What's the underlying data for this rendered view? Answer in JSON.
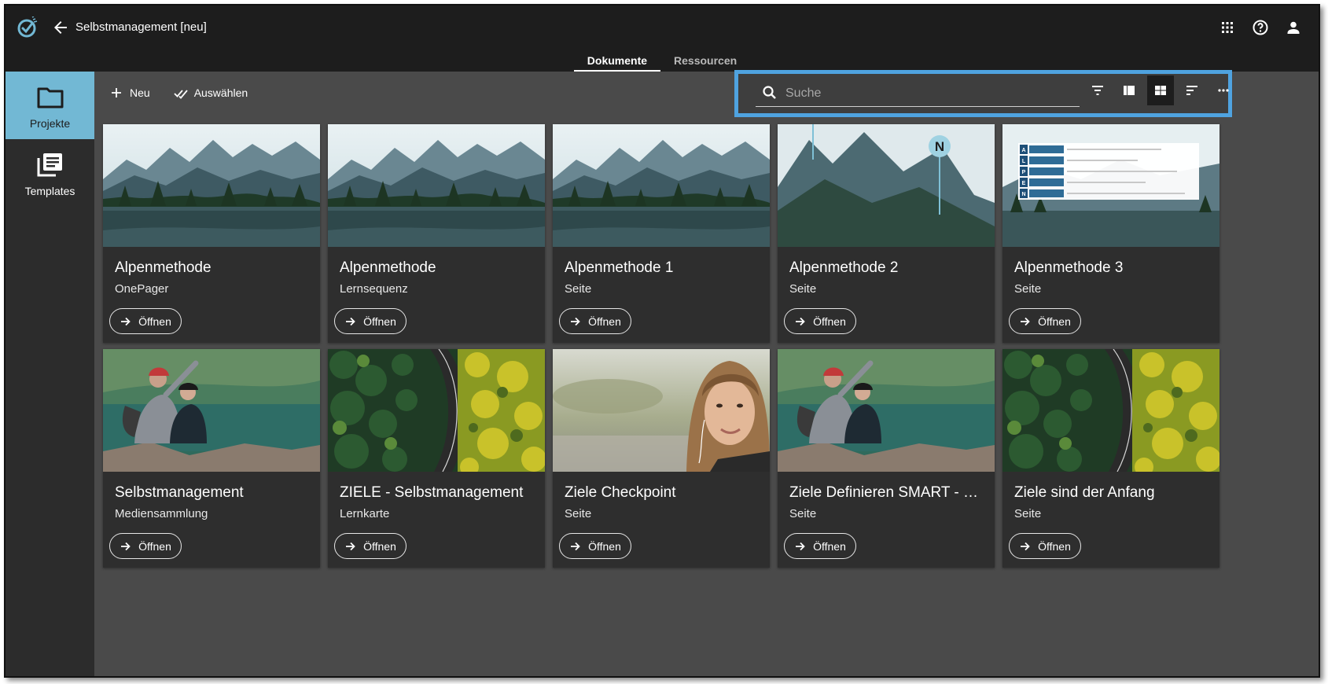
{
  "app": {
    "title": "Selbstmanagement [neu]"
  },
  "tabs": [
    {
      "label": "Dokumente",
      "active": true
    },
    {
      "label": "Ressourcen",
      "active": false
    }
  ],
  "sidebar": {
    "items": [
      {
        "label": "Projekte",
        "icon": "folder-icon",
        "active": true
      },
      {
        "label": "Templates",
        "icon": "library-books-icon",
        "active": false
      }
    ]
  },
  "toolbar": {
    "new_label": "Neu",
    "select_label": "Auswählen"
  },
  "search": {
    "placeholder": "Suche",
    "value": ""
  },
  "colors": {
    "accent": "#72b8d4",
    "highlight_border": "#4fa3e0",
    "topbar": "#1d1d1d",
    "background": "#4a4a4a",
    "card": "#2e2e2e"
  },
  "cards": [
    {
      "title": "Alpenmethode",
      "subtitle": "OnePager",
      "open_label": "Öffnen",
      "thumb": "mountain-lake"
    },
    {
      "title": "Alpenmethode",
      "subtitle": "Lernsequenz",
      "open_label": "Öffnen",
      "thumb": "mountain-lake"
    },
    {
      "title": "Alpenmethode 1",
      "subtitle": "Seite",
      "open_label": "Öffnen",
      "thumb": "mountain-lake"
    },
    {
      "title": "Alpenmethode 2",
      "subtitle": "Seite",
      "open_label": "Öffnen",
      "thumb": "mountain-peak",
      "thumb_marker": "N"
    },
    {
      "title": "Alpenmethode 3",
      "subtitle": "Seite",
      "open_label": "Öffnen",
      "thumb": "mountain-table",
      "thumb_letters": [
        "A",
        "L",
        "P",
        "E",
        "N"
      ]
    },
    {
      "title": "Selbstmanagement",
      "subtitle": "Mediensammlung",
      "open_label": "Öffnen",
      "thumb": "hikers-lake"
    },
    {
      "title": "ZIELE - Selbstmanagement",
      "subtitle": "Lernkarte",
      "open_label": "Öffnen",
      "thumb": "forest-road"
    },
    {
      "title": "Ziele Checkpoint",
      "subtitle": "Seite",
      "open_label": "Öffnen",
      "thumb": "woman-portrait"
    },
    {
      "title": "Ziele Definieren SMART - Re...",
      "subtitle": "Seite",
      "open_label": "Öffnen",
      "thumb": "hikers-lake"
    },
    {
      "title": "Ziele sind der Anfang",
      "subtitle": "Seite",
      "open_label": "Öffnen",
      "thumb": "forest-road"
    }
  ]
}
